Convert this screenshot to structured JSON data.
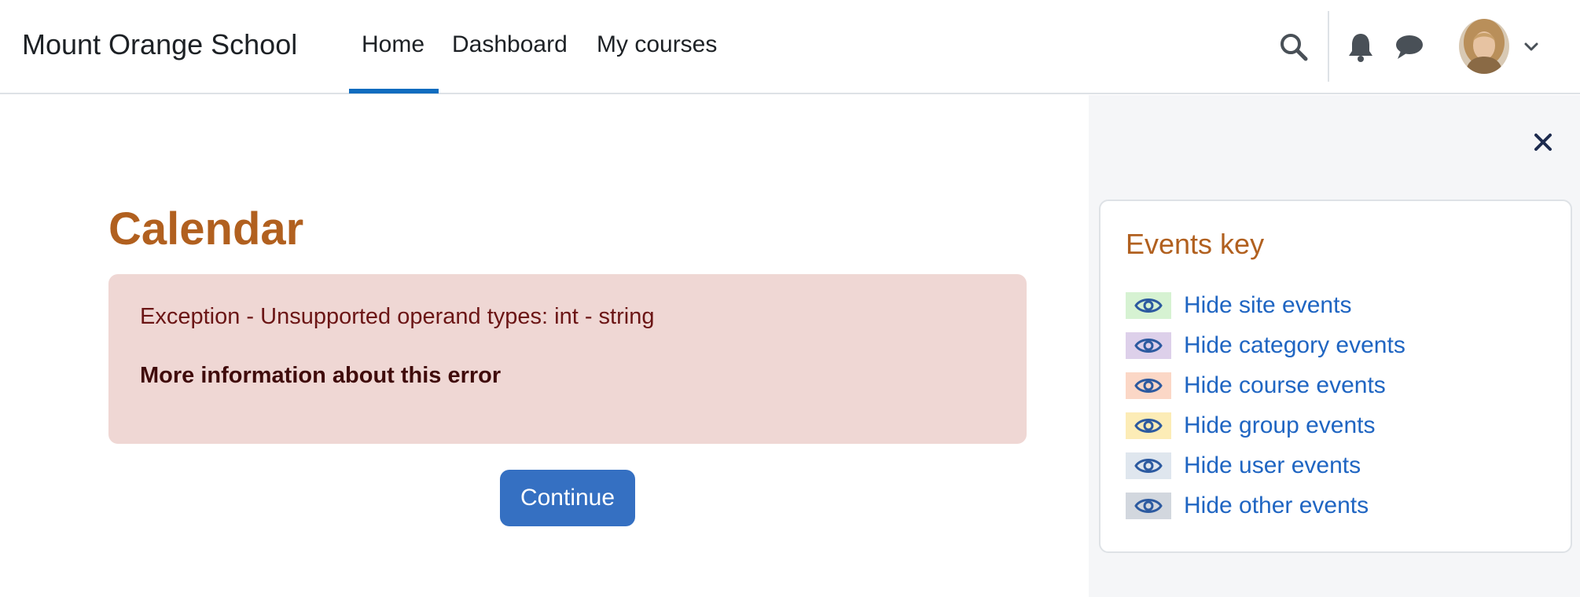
{
  "header": {
    "site_name": "Mount Orange School",
    "nav": [
      {
        "label": "Home",
        "active": true
      },
      {
        "label": "Dashboard"
      },
      {
        "label": "My courses"
      }
    ]
  },
  "main": {
    "title": "Calendar",
    "error_message": "Exception - Unsupported operand types: int - string",
    "more_info": "More information about this error",
    "continue_label": "Continue"
  },
  "drawer": {
    "events_key_title": "Events key",
    "events": [
      {
        "label": "Hide site events",
        "color": "#d6f2d2"
      },
      {
        "label": "Hide category events",
        "color": "#ddd0ea"
      },
      {
        "label": "Hide course events",
        "color": "#fbd7c6"
      },
      {
        "label": "Hide group events",
        "color": "#fcecb6"
      },
      {
        "label": "Hide user events",
        "color": "#dfe6ee"
      },
      {
        "label": "Hide other events",
        "color": "#d2d7de"
      }
    ]
  },
  "colors": {
    "brand_blue": "#0f6cbf",
    "button_blue": "#3570c2",
    "heading_orange": "#b1601f",
    "alert_bg": "#efd7d4",
    "link_blue": "#1f65c2"
  },
  "icons": [
    "search-icon",
    "bell-icon",
    "chat-icon",
    "chevron-down-icon",
    "close-icon",
    "eye-icon"
  ]
}
